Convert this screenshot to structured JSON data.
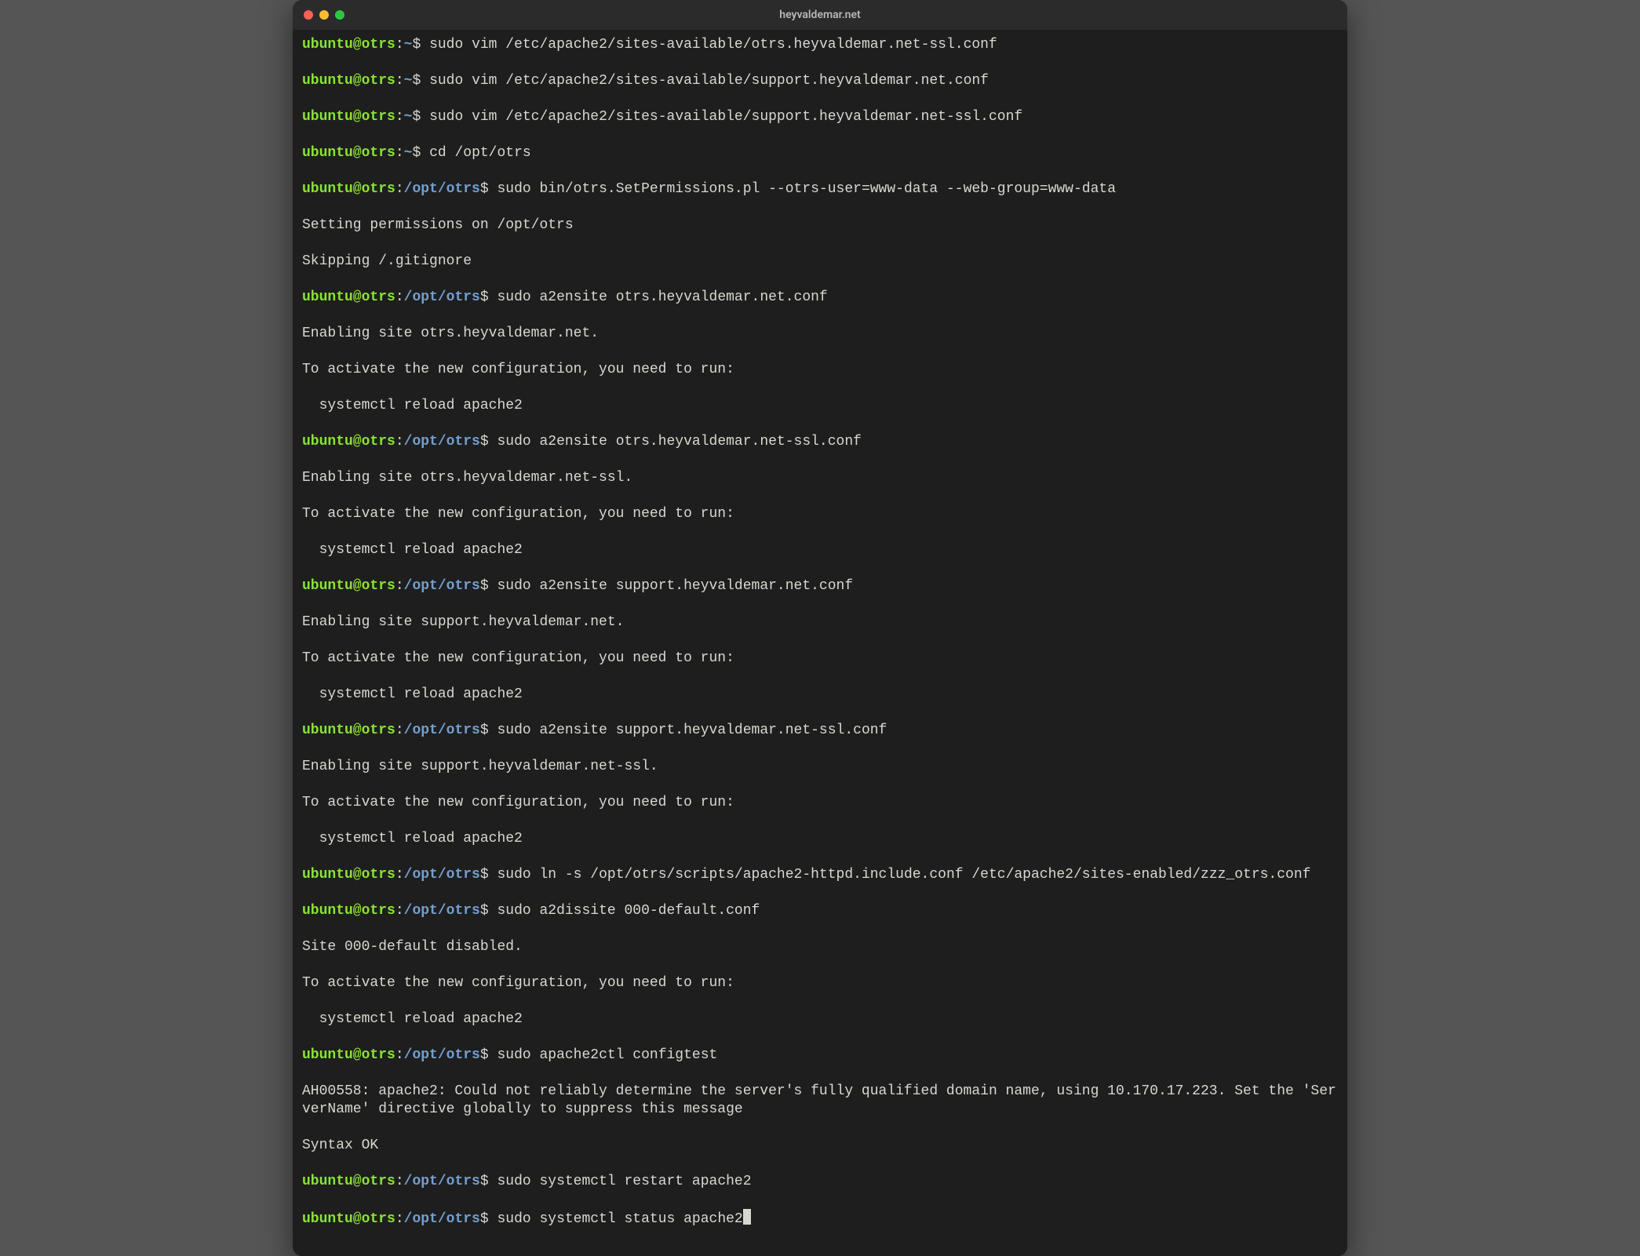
{
  "window": {
    "title": "heyvaldemar.net",
    "traffic_light_colors": {
      "close": "#ff5f57",
      "minimize": "#febc2e",
      "maximize": "#28c840"
    }
  },
  "prompt": {
    "user_host": "ubuntu@otrs",
    "home_path": "~",
    "cwd_path": "/opt/otrs",
    "symbol": "$"
  },
  "lines": [
    {
      "type": "prompt",
      "path": "~",
      "cmd": "sudo vim /etc/apache2/sites-available/otrs.heyvaldemar.net-ssl.conf"
    },
    {
      "type": "prompt",
      "path": "~",
      "cmd": "sudo vim /etc/apache2/sites-available/support.heyvaldemar.net.conf"
    },
    {
      "type": "prompt",
      "path": "~",
      "cmd": "sudo vim /etc/apache2/sites-available/support.heyvaldemar.net-ssl.conf"
    },
    {
      "type": "prompt",
      "path": "~",
      "cmd": "cd /opt/otrs"
    },
    {
      "type": "prompt",
      "path": "/opt/otrs",
      "cmd": "sudo bin/otrs.SetPermissions.pl --otrs-user=www-data --web-group=www-data"
    },
    {
      "type": "out",
      "text": "Setting permissions on /opt/otrs"
    },
    {
      "type": "out",
      "text": "Skipping /.gitignore"
    },
    {
      "type": "prompt",
      "path": "/opt/otrs",
      "cmd": "sudo a2ensite otrs.heyvaldemar.net.conf"
    },
    {
      "type": "out",
      "text": "Enabling site otrs.heyvaldemar.net."
    },
    {
      "type": "out",
      "text": "To activate the new configuration, you need to run:"
    },
    {
      "type": "out",
      "text": "  systemctl reload apache2"
    },
    {
      "type": "prompt",
      "path": "/opt/otrs",
      "cmd": "sudo a2ensite otrs.heyvaldemar.net-ssl.conf"
    },
    {
      "type": "out",
      "text": "Enabling site otrs.heyvaldemar.net-ssl."
    },
    {
      "type": "out",
      "text": "To activate the new configuration, you need to run:"
    },
    {
      "type": "out",
      "text": "  systemctl reload apache2"
    },
    {
      "type": "prompt",
      "path": "/opt/otrs",
      "cmd": "sudo a2ensite support.heyvaldemar.net.conf"
    },
    {
      "type": "out",
      "text": "Enabling site support.heyvaldemar.net."
    },
    {
      "type": "out",
      "text": "To activate the new configuration, you need to run:"
    },
    {
      "type": "out",
      "text": "  systemctl reload apache2"
    },
    {
      "type": "prompt",
      "path": "/opt/otrs",
      "cmd": "sudo a2ensite support.heyvaldemar.net-ssl.conf"
    },
    {
      "type": "out",
      "text": "Enabling site support.heyvaldemar.net-ssl."
    },
    {
      "type": "out",
      "text": "To activate the new configuration, you need to run:"
    },
    {
      "type": "out",
      "text": "  systemctl reload apache2"
    },
    {
      "type": "prompt",
      "path": "/opt/otrs",
      "cmd": "sudo ln -s /opt/otrs/scripts/apache2-httpd.include.conf /etc/apache2/sites-enabled/zzz_otrs.conf"
    },
    {
      "type": "prompt",
      "path": "/opt/otrs",
      "cmd": "sudo a2dissite 000-default.conf"
    },
    {
      "type": "out",
      "text": "Site 000-default disabled."
    },
    {
      "type": "out",
      "text": "To activate the new configuration, you need to run:"
    },
    {
      "type": "out",
      "text": "  systemctl reload apache2"
    },
    {
      "type": "prompt",
      "path": "/opt/otrs",
      "cmd": "sudo apache2ctl configtest"
    },
    {
      "type": "out",
      "text": "AH00558: apache2: Could not reliably determine the server's fully qualified domain name, using 10.170.17.223. Set the 'ServerName' directive globally to suppress this message"
    },
    {
      "type": "out",
      "text": "Syntax OK"
    },
    {
      "type": "prompt",
      "path": "/opt/otrs",
      "cmd": "sudo systemctl restart apache2"
    },
    {
      "type": "prompt",
      "path": "/opt/otrs",
      "cmd": "sudo systemctl status apache2",
      "cursor": true
    }
  ]
}
